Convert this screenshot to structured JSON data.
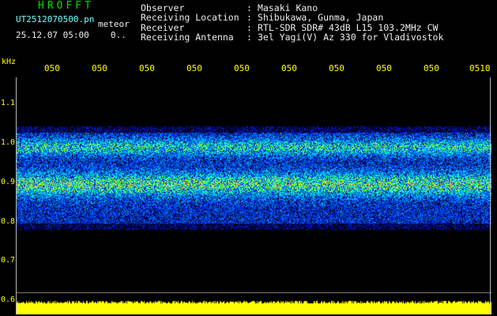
{
  "app": {
    "title": "HROFFT"
  },
  "header": {
    "filename": "UT2512070500.pn",
    "mode": "meteor",
    "timestamp": "25.12.07 05:00",
    "count": "0.."
  },
  "info": [
    {
      "key": "Observer",
      "sep": ":",
      "value": "Masaki Kano"
    },
    {
      "key": "Receiving Location",
      "sep": ":",
      "value": "Shibukawa, Gunma, Japan"
    },
    {
      "key": "Receiver",
      "sep": ":",
      "value": "RTL-SDR SDR# 43dB L15 103.2MHz CW"
    },
    {
      "key": "Receiving Antenna",
      "sep": ":",
      "value": "3el Yagi(V) Az 330 for Vladivostok"
    }
  ],
  "axis": {
    "unit": "kHz",
    "y_labels": [
      "1.1",
      "1.0",
      "0.9",
      "0.8",
      "0.7",
      "0.6"
    ],
    "x_labels": [
      "050",
      "050",
      "050",
      "050",
      "050",
      "050",
      "050",
      "050",
      "050",
      "0510"
    ]
  },
  "colors": {
    "title": "#00e000",
    "filename": "#77ffff",
    "axis_labels": "#ffff00",
    "info_text": "#eeeeee",
    "signal_bar": "#ffff00",
    "background": "#000000"
  }
}
